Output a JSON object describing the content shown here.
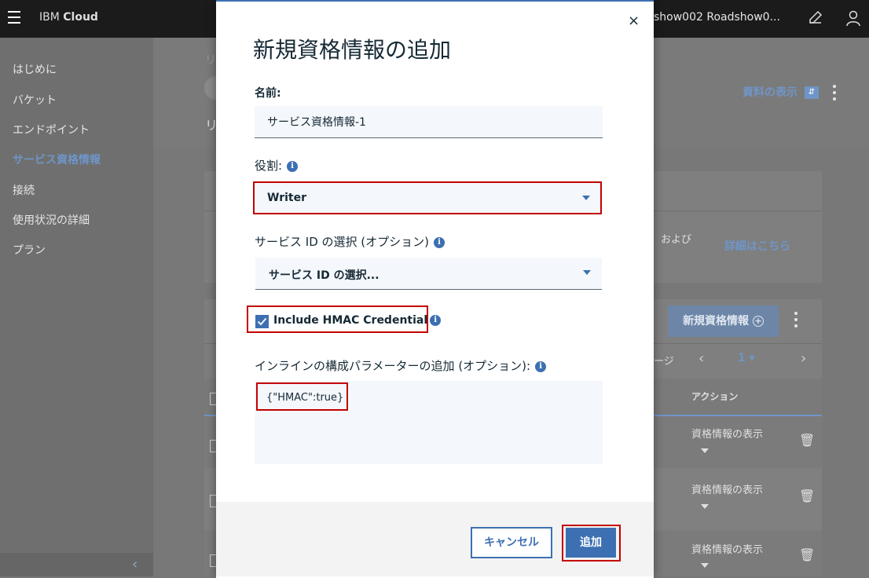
{
  "header": {
    "brand_light": "IBM",
    "brand_bold": "Cloud",
    "account": "show002 Roadshow0..."
  },
  "sidebar": {
    "items": [
      {
        "label": "はじめに",
        "active": false
      },
      {
        "label": "バケット",
        "active": false
      },
      {
        "label": "エンドポイント",
        "active": false
      },
      {
        "label": "サービス資格情報",
        "active": true
      },
      {
        "label": "接続",
        "active": false
      },
      {
        "label": "使用状況の詳細",
        "active": false
      },
      {
        "label": "プラン",
        "active": false
      }
    ],
    "collapse": "‹"
  },
  "background": {
    "breadcrumb_partial": "リ",
    "title_partial": "リ",
    "view_docs": "資料の表示",
    "and_text": "および",
    "learn_more": "詳細はこちら",
    "new_credential_button": "新規資格情報",
    "page_partial": "ージ",
    "page_number": "1",
    "actions_header": "アクション",
    "rows": [
      {
        "action": "資格情報の表示"
      },
      {
        "action": "資格情報の表示"
      },
      {
        "action": "資格情報の表示"
      }
    ]
  },
  "modal": {
    "title": "新規資格情報の追加",
    "close": "×",
    "name_label": "名前:",
    "name_value": "サービス資格情報-1",
    "role_label": "役割:",
    "role_value": "Writer",
    "service_id_label": "サービス ID の選択 (オプション)",
    "service_id_value": "サービス ID の選択...",
    "hmac_label": "Include HMAC Credential",
    "hmac_checked": true,
    "params_label": "インラインの構成パラメーターの追加 (オプション):",
    "params_value": "{\"HMAC\":true}",
    "cancel": "キャンセル",
    "add": "追加"
  },
  "colors": {
    "accent": "#3d70b2",
    "highlight": "#c40000"
  }
}
